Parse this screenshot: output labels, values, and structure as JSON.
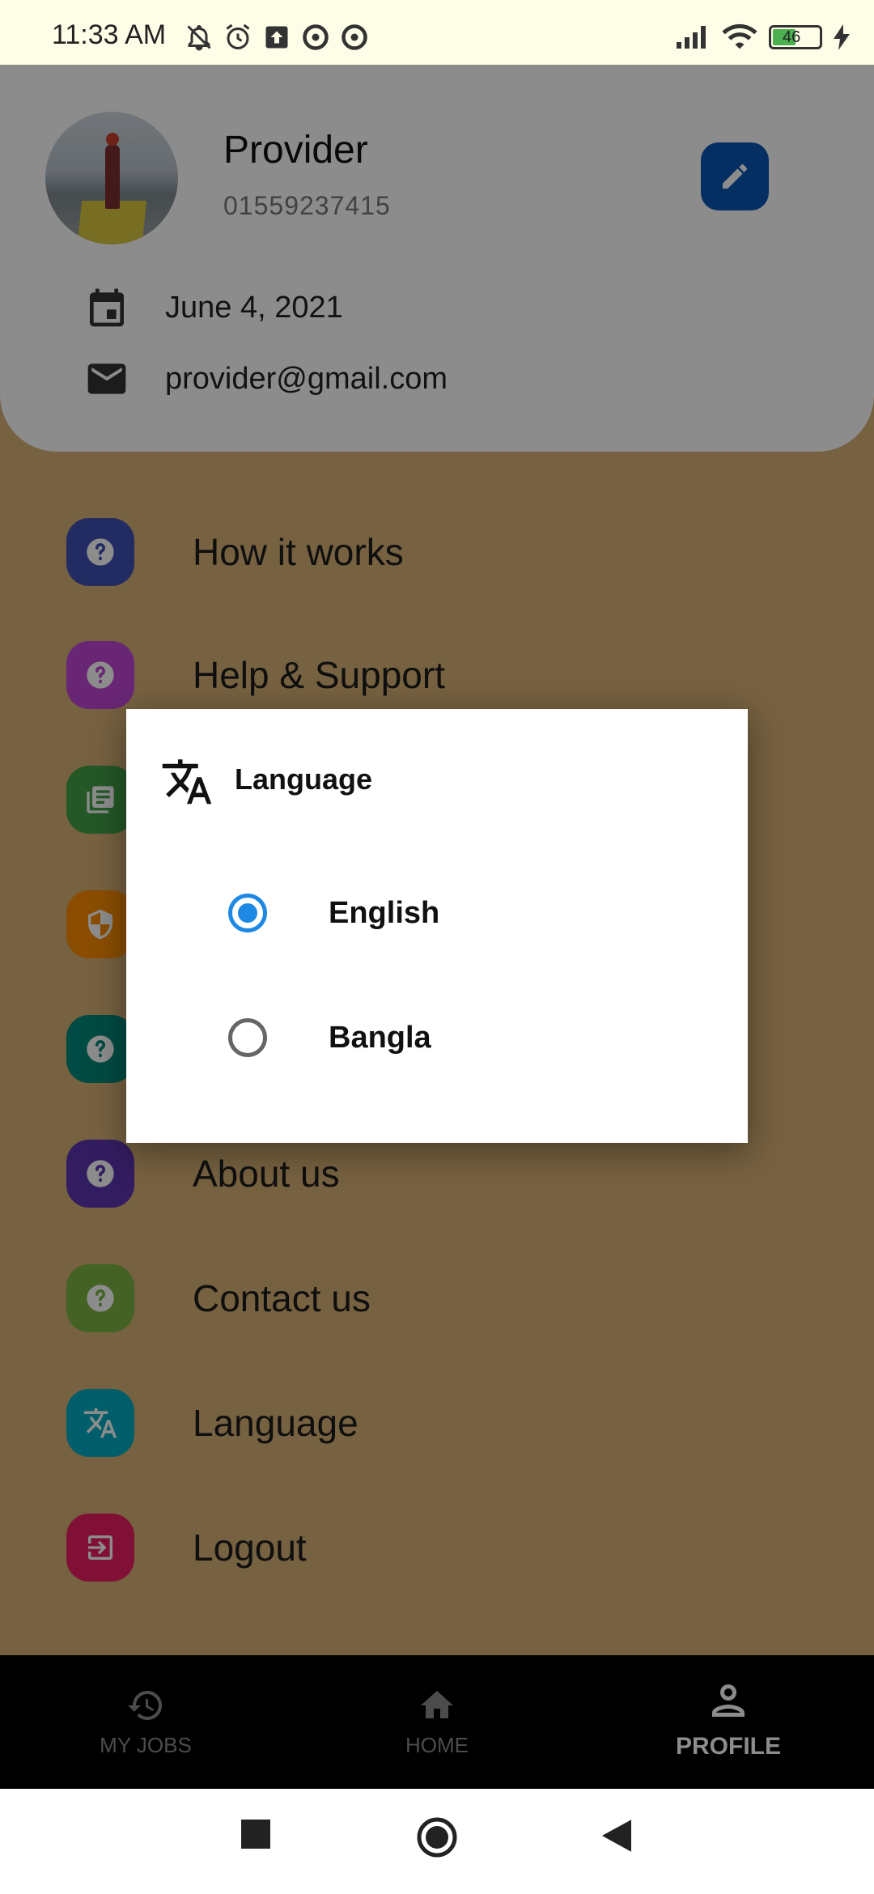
{
  "status_bar": {
    "time": "11:33 AM",
    "battery": "46"
  },
  "profile": {
    "name": "Provider",
    "phone": "01559237415",
    "date": "June 4, 2021",
    "email": "provider@gmail.com"
  },
  "menu": {
    "items": [
      {
        "label": "How it works",
        "icon": "help-icon",
        "color": "#3f51b5"
      },
      {
        "label": "Help & Support",
        "icon": "help-icon",
        "color": "#c046d6"
      },
      {
        "label": "",
        "icon": "article-icon",
        "color": "#43a047"
      },
      {
        "label": "",
        "icon": "shield-icon",
        "color": "#fb8c00"
      },
      {
        "label": "",
        "icon": "help-icon",
        "color": "#00897b"
      },
      {
        "label": "About us",
        "icon": "help-icon",
        "color": "#5e35b1"
      },
      {
        "label": "Contact us",
        "icon": "help-icon",
        "color": "#7cb342"
      },
      {
        "label": "Language",
        "icon": "translate-icon",
        "color": "#00acc1"
      },
      {
        "label": "Logout",
        "icon": "logout-icon",
        "color": "#e91e63"
      }
    ]
  },
  "bottom_nav": {
    "items": [
      {
        "label": "MY JOBS",
        "icon": "history-icon"
      },
      {
        "label": "HOME",
        "icon": "home-icon"
      },
      {
        "label": "PROFILE",
        "icon": "person-icon"
      }
    ],
    "active": "PROFILE"
  },
  "dialog": {
    "title": "Language",
    "options": [
      {
        "label": "English",
        "selected": true
      },
      {
        "label": "Bangla",
        "selected": false
      }
    ]
  },
  "colors": {
    "background": "#d7b175",
    "accent_blue": "#1e88e5",
    "edit_button": "#0a55b5"
  }
}
